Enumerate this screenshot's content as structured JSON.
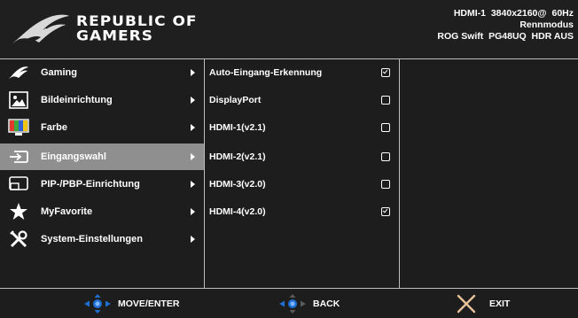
{
  "header": {
    "brand_line1": "REPUBLIC OF",
    "brand_line2": "GAMERS",
    "status_line1": "HDMI-1  3840x2160@  60Hz",
    "status_line2": "Rennmodus",
    "status_line3": "ROG Swift  PG48UQ  HDR AUS"
  },
  "menu": {
    "items": [
      {
        "label": "Gaming",
        "icon": "rog-eye-icon"
      },
      {
        "label": "Bildeinrichtung",
        "icon": "image-icon"
      },
      {
        "label": "Farbe",
        "icon": "color-bars-icon"
      },
      {
        "label": "Eingangswahl",
        "icon": "input-icon",
        "selected": true
      },
      {
        "label": "PIP-/PBP-Einrichtung",
        "icon": "pip-icon"
      },
      {
        "label": "MyFavorite",
        "icon": "star-icon"
      },
      {
        "label": "System-Einstellungen",
        "icon": "tools-icon"
      }
    ]
  },
  "options": {
    "items": [
      {
        "label": "Auto-Eingang-Erkennung",
        "checked": true
      },
      {
        "label": "DisplayPort",
        "checked": false
      },
      {
        "label": "HDMI-1(v2.1)",
        "checked": false
      },
      {
        "label": "HDMI-2(v2.1)",
        "checked": false
      },
      {
        "label": "HDMI-3(v2.0)",
        "checked": false
      },
      {
        "label": "HDMI-4(v2.0)",
        "checked": true
      }
    ]
  },
  "footer": {
    "move_label": "MOVE/ENTER",
    "back_label": "BACK",
    "exit_label": "EXIT"
  },
  "colors": {
    "background": "#1d1d1d",
    "selected_row": "#8f8f8f",
    "divider": "#bdbdbd",
    "joystick_blue": "#1f6fd1",
    "exit_x": "#e8c39a"
  }
}
